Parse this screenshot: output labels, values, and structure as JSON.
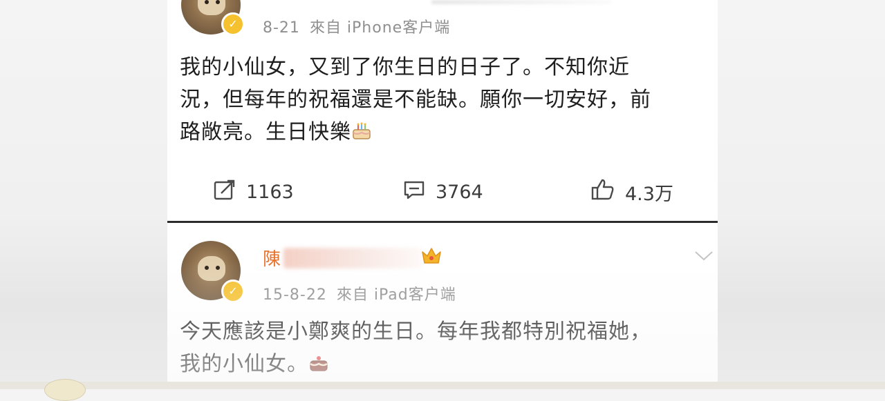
{
  "post1": {
    "timestamp": "8-21",
    "source": "來自 iPhone客户端",
    "text_lines": [
      "我的小仙女，又到了你生日的日子了。不知你近",
      "況，但每年的祝福還是不能缺。願你一切安好，前",
      "路敞亮。生日快樂"
    ],
    "emoji": "cake-emoji",
    "actions": {
      "repost_icon": "share-icon",
      "repost_count": "1163",
      "comment_icon": "comment-icon",
      "comment_count": "3764",
      "like_icon": "thumbs-up-icon",
      "like_count": "4.3万"
    }
  },
  "post2": {
    "username_visible": "陳",
    "verified_badge": "crown-icon",
    "timestamp": "15-8-22",
    "source": "來自 iPad客户端",
    "text_lines": [
      "今天應該是小鄭爽的生日。每年我都特別祝福她，",
      "我的小仙女。"
    ],
    "emoji": "cake-emoji",
    "menu_icon": "chevron-down-icon"
  },
  "colors": {
    "username": "#e8732f",
    "meta": "#8f8f8f",
    "text": "#1e1e1e",
    "verified": "#f6c12e"
  }
}
